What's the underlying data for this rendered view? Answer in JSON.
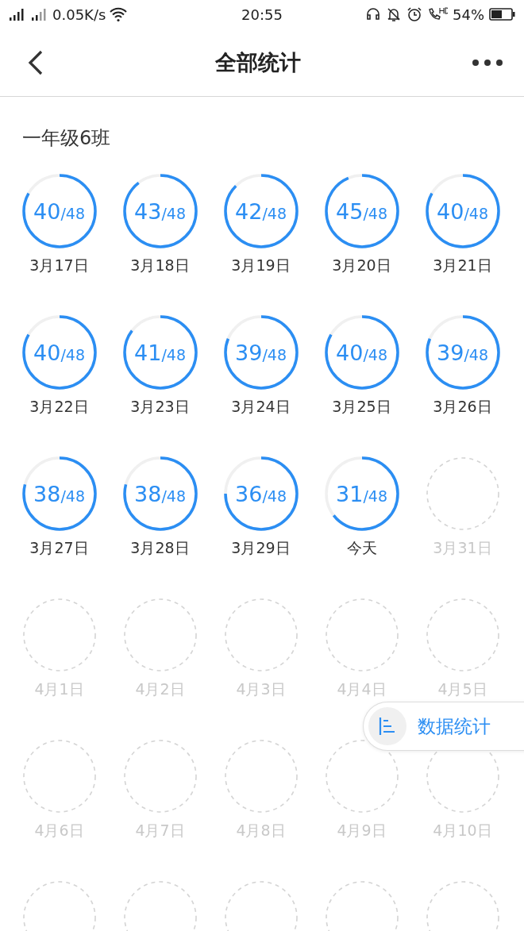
{
  "status_bar": {
    "speed": "0.05K/s",
    "time": "20:55",
    "battery": "54%"
  },
  "header": {
    "title": "全部统计"
  },
  "section": {
    "title": "一年级6班"
  },
  "days": [
    {
      "kind": "done",
      "count": "40",
      "total": "/48",
      "date": "3月17日"
    },
    {
      "kind": "done",
      "count": "43",
      "total": "/48",
      "date": "3月18日"
    },
    {
      "kind": "done",
      "count": "42",
      "total": "/48",
      "date": "3月19日"
    },
    {
      "kind": "done",
      "count": "45",
      "total": "/48",
      "date": "3月20日"
    },
    {
      "kind": "done",
      "count": "40",
      "total": "/48",
      "date": "3月21日"
    },
    {
      "kind": "done",
      "count": "40",
      "total": "/48",
      "date": "3月22日"
    },
    {
      "kind": "done",
      "count": "41",
      "total": "/48",
      "date": "3月23日"
    },
    {
      "kind": "done",
      "count": "39",
      "total": "/48",
      "date": "3月24日"
    },
    {
      "kind": "done",
      "count": "40",
      "total": "/48",
      "date": "3月25日"
    },
    {
      "kind": "done",
      "count": "39",
      "total": "/48",
      "date": "3月26日"
    },
    {
      "kind": "done",
      "count": "38",
      "total": "/48",
      "date": "3月27日"
    },
    {
      "kind": "done",
      "count": "38",
      "total": "/48",
      "date": "3月28日"
    },
    {
      "kind": "done",
      "count": "36",
      "total": "/48",
      "date": "3月29日"
    },
    {
      "kind": "done",
      "count": "31",
      "total": "/48",
      "date": "今天"
    },
    {
      "kind": "future",
      "date": "3月31日"
    },
    {
      "kind": "future",
      "date": "4月1日"
    },
    {
      "kind": "future",
      "date": "4月2日"
    },
    {
      "kind": "future",
      "date": "4月3日"
    },
    {
      "kind": "future",
      "date": "4月4日"
    },
    {
      "kind": "future",
      "date": "4月5日"
    },
    {
      "kind": "future",
      "date": "4月6日"
    },
    {
      "kind": "future",
      "date": "4月7日"
    },
    {
      "kind": "future",
      "date": "4月8日"
    },
    {
      "kind": "future",
      "date": "4月9日"
    },
    {
      "kind": "future",
      "date": "4月10日"
    },
    {
      "kind": "future"
    },
    {
      "kind": "future"
    },
    {
      "kind": "future"
    },
    {
      "kind": "future"
    },
    {
      "kind": "future"
    }
  ],
  "float_button": {
    "label": "数据统计"
  }
}
